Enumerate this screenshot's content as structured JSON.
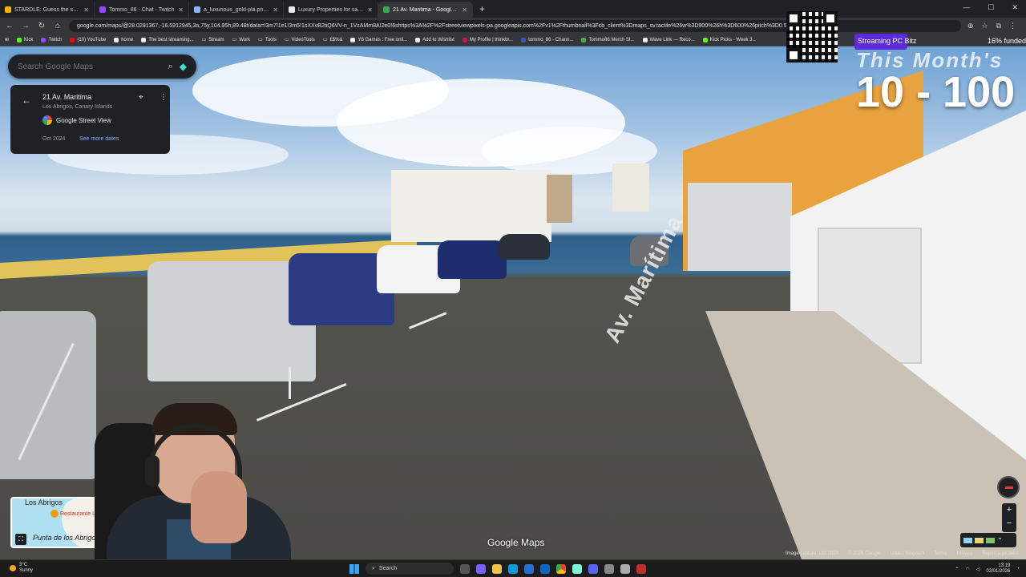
{
  "browser": {
    "tabs": [
      {
        "title": "STARDLE: Guess the ship!",
        "color": "#f4b400",
        "active": false
      },
      {
        "title": "Tommo_86 - Chat - Twitch",
        "color": "#9146ff",
        "active": false
      },
      {
        "title": "a_luxurious_gold-pla.png (960×",
        "color": "#8ab4f8",
        "active": false
      },
      {
        "title": "Luxury Properties for sale in Te",
        "color": "#e8eaed",
        "active": false
      },
      {
        "title": "21 Av. Maritima - Google Maps",
        "color": "#34a853",
        "active": true
      }
    ],
    "url": "google.com/maps/@28.0281367,-16.5912945,3a,75y,104.95h,89.48t/data=!3m7!1e1!3m5!1sXXvB2tiQ6VV-n_1VzAMm8A!2e0!6shttps%3A%2F%2Fstreetviewpixels-pa.googleapis.com%2Fv1%2Fthumbnail%3Fcb_client%3Dmaps_sv.tactile%26w%3D900%26h%3D600%26pitch%3D0.5236651",
    "bookmarks": [
      {
        "label": "Kick",
        "color": "#53fc18"
      },
      {
        "label": "Twitch",
        "color": "#9146ff"
      },
      {
        "label": "(10) YouTube",
        "color": "#ff0000"
      },
      {
        "label": "home",
        "color": "#e8eaed"
      },
      {
        "label": "The best streaming...",
        "color": "#e8eaed"
      },
      {
        "label": "Stream",
        "color": "#e8eaed"
      },
      {
        "label": "Work",
        "color": "#e8eaed"
      },
      {
        "label": "Tools",
        "color": "#e8eaed"
      },
      {
        "label": "VideoTools",
        "color": "#e8eaed"
      },
      {
        "label": "£$%&",
        "color": "#e8eaed"
      },
      {
        "label": "Y8 Games : Free onli...",
        "color": "#e8eaed"
      },
      {
        "label": "Add to Wishlist",
        "color": "#e8eaed"
      },
      {
        "label": "My Profile | thinkbr...",
        "color": "#c2185b"
      },
      {
        "label": "tommo_86 - Chann...",
        "color": "#3f51b5"
      },
      {
        "label": "Tommo86 Merch St...",
        "color": "#4caf50"
      },
      {
        "label": "Wave Link — Reco...",
        "color": "#e8eaed"
      },
      {
        "label": "Kick Picks - Week 3...",
        "color": "#53fc18"
      }
    ]
  },
  "maps": {
    "search_placeholder": "Search Google Maps",
    "place_title": "21 Av. Maritima",
    "place_subtitle": "Los Abrigos, Canary Islands",
    "source_label": "Google Street View",
    "capture_date": "Oct 2024",
    "see_more_dates": "See more dates",
    "street_name": "Av. Marítima",
    "wordmark": "Google Maps",
    "attribution": [
      "Image capture: Oct 2024",
      "© 2026 Google",
      "United Kingdom",
      "Terms",
      "Privacy",
      "Report a problem"
    ],
    "minimap": {
      "town": "Los Abrigos",
      "poi": "Restaurante L",
      "point": "Punta de los Abrigos"
    }
  },
  "overlay": {
    "goal_label": "Streaming PC Bitz",
    "goal_percent": "16% funded",
    "month_label": "This Month's",
    "range": "10 - 100"
  },
  "taskbar": {
    "temp": "3°C",
    "weather": "Sunny",
    "search": "Search",
    "time": "13:19",
    "date": "02/01/2026"
  }
}
